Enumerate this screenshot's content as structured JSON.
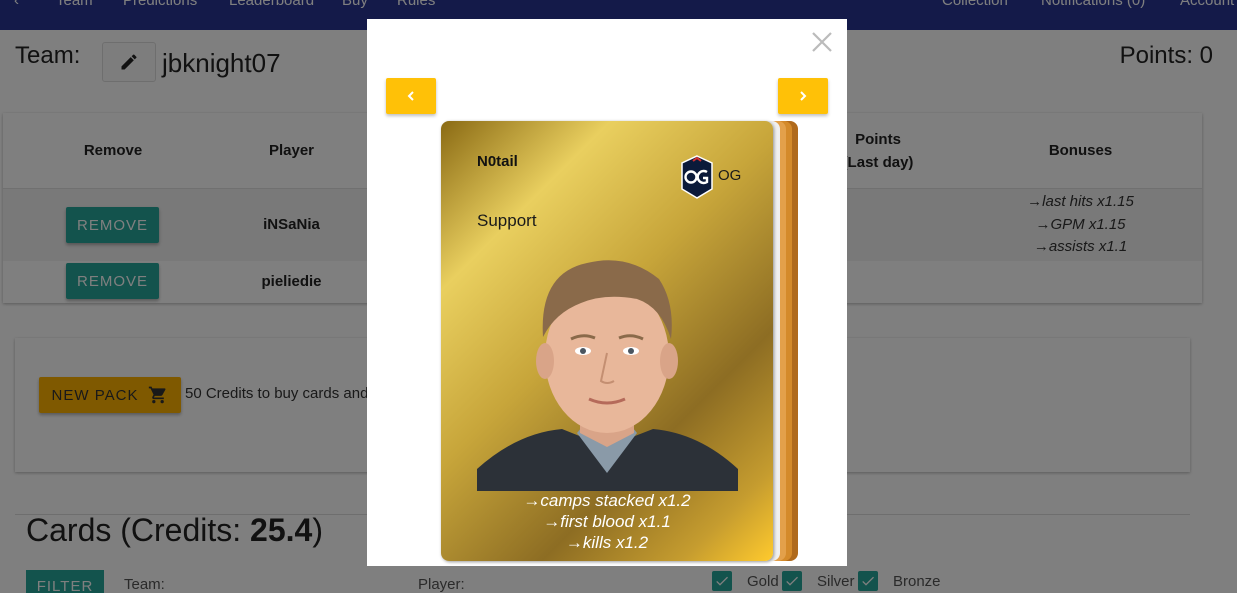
{
  "nav": {
    "items": [
      "Team",
      "Predictions",
      "Leaderboard",
      "Buy",
      "Rules"
    ],
    "right_items": [
      "Collection",
      "Notifications (0)",
      "Account"
    ]
  },
  "team": {
    "label": "Team:",
    "name": "jbknight07",
    "points": "Points: 0"
  },
  "table": {
    "headers": {
      "remove": "Remove",
      "player": "Player",
      "points_line1": "Points",
      "points_line2": "(Last day)",
      "bonuses": "Bonuses"
    },
    "rows": [
      {
        "remove_label": "REMOVE",
        "player": "iNSaNia",
        "bonuses": [
          "→last hits x1.15",
          "→GPM x1.15",
          "→assists x1.1"
        ]
      },
      {
        "remove_label": "REMOVE",
        "player": "pieliedie",
        "bonuses": []
      }
    ]
  },
  "pack": {
    "button_label": "NEW PACK",
    "text": "50 Credits to buy cards and"
  },
  "cards": {
    "heading_prefix": "Cards (Credits: ",
    "credits": "25.4",
    "heading_suffix": ")"
  },
  "filters": {
    "button_label": "FILTER",
    "team_label": "Team:",
    "player_label": "Player:",
    "gold_label": "Gold",
    "silver_label": "Silver",
    "bronze_label": "Bronze",
    "gold_checked": true,
    "silver_checked": true,
    "bronze_checked": true
  },
  "modal": {
    "close_icon": "close-icon",
    "prev_icon": "chevron-left-icon",
    "next_icon": "chevron-right-icon",
    "card": {
      "name": "N0tail",
      "team": "OG",
      "role": "Support",
      "tier_color": "#d4af37",
      "bonuses": [
        "→camps stacked x1.2",
        "→first blood x1.1",
        "→kills x1.2"
      ]
    }
  },
  "colors": {
    "nav": "#283593",
    "teal": "#26a69a",
    "amber": "#ffb300",
    "yellow": "#ffc107"
  }
}
